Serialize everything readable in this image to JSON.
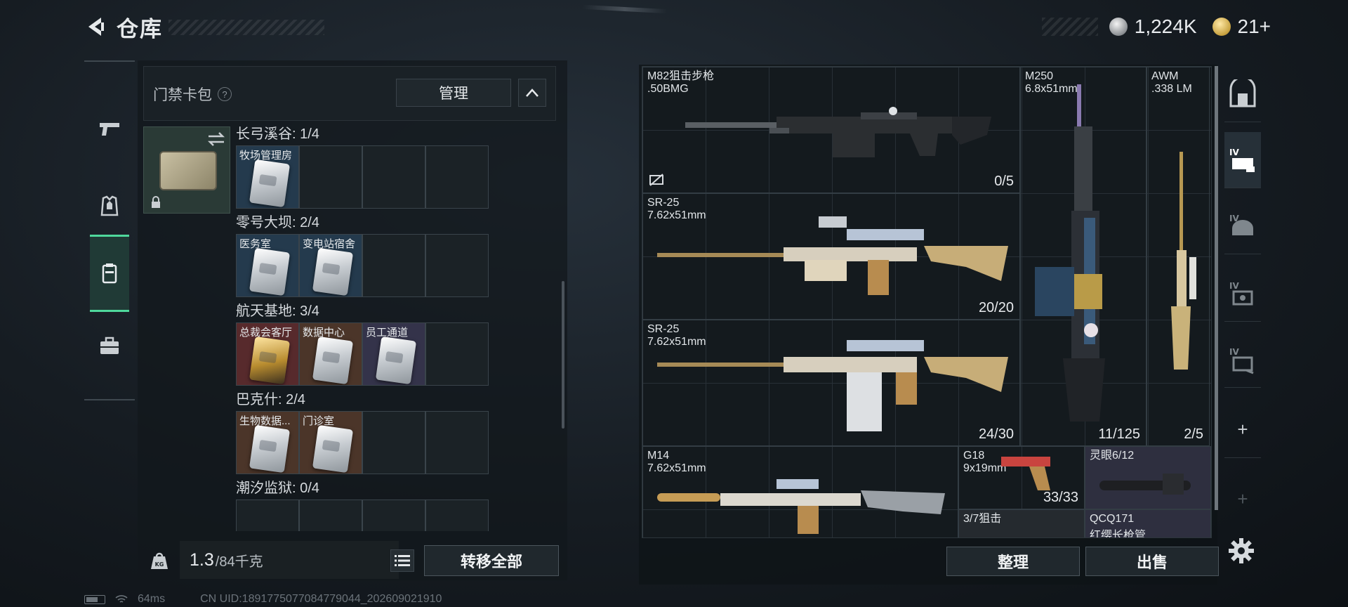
{
  "header": {
    "title": "仓库",
    "currency": [
      {
        "icon": "silver-coin-icon",
        "value": "1,224K"
      },
      {
        "icon": "gold-coin-icon",
        "value": "21+"
      }
    ]
  },
  "left_nav": [
    {
      "name": "weapons",
      "icon": "pistol-icon",
      "active": false
    },
    {
      "name": "armor",
      "icon": "armor-icon",
      "active": false
    },
    {
      "name": "keycard-pack",
      "icon": "keycard-pack-icon",
      "active": true
    },
    {
      "name": "toolbox",
      "icon": "briefcase-icon",
      "active": false
    }
  ],
  "keycard_panel": {
    "title": "门禁卡包",
    "help": "?",
    "manage_label": "管理",
    "regions": [
      {
        "label": "长弓溪谷: 1/4",
        "slots": [
          {
            "label": "牧场管理房",
            "color": "blue",
            "card": "white"
          },
          {
            "label": "",
            "color": "empty"
          },
          {
            "label": "",
            "color": "empty"
          },
          {
            "label": "",
            "color": "empty"
          }
        ]
      },
      {
        "label": "零号大坝: 2/4",
        "slots": [
          {
            "label": "医务室",
            "color": "blue",
            "card": "white"
          },
          {
            "label": "变电站宿舍",
            "color": "blue",
            "card": "white"
          },
          {
            "label": "",
            "color": "empty"
          },
          {
            "label": "",
            "color": "empty"
          }
        ]
      },
      {
        "label": "航天基地: 3/4",
        "slots": [
          {
            "label": "总裁会客厅",
            "color": "red",
            "card": "gold"
          },
          {
            "label": "数据中心",
            "color": "brown",
            "card": "white"
          },
          {
            "label": "员工通道",
            "color": "purple",
            "card": "white"
          },
          {
            "label": "",
            "color": "empty"
          }
        ]
      },
      {
        "label": "巴克什: 2/4",
        "slots": [
          {
            "label": "生物数据...",
            "color": "brown",
            "card": "white"
          },
          {
            "label": "门诊室",
            "color": "brown",
            "card": "white"
          },
          {
            "label": "",
            "color": "empty"
          },
          {
            "label": "",
            "color": "empty"
          }
        ]
      },
      {
        "label": "潮汐监狱: 0/4",
        "slots": [
          {
            "label": "",
            "color": "empty"
          },
          {
            "label": "",
            "color": "empty"
          },
          {
            "label": "",
            "color": "empty"
          },
          {
            "label": "",
            "color": "empty"
          }
        ]
      }
    ]
  },
  "weight": {
    "value": "1.3",
    "max": "/84千克",
    "icon": "kg-weight-icon"
  },
  "transfer_all_label": "转移全部",
  "status": {
    "ping": "64ms",
    "uid": "CN UID:1891775077084779044_202609021910"
  },
  "weapons": [
    {
      "name": "M82狙击步枪",
      "ammo": ".50BMG",
      "count": "0/5"
    },
    {
      "name": "M250",
      "ammo": "6.8x51mm",
      "count": "11/125"
    },
    {
      "name": "AWM",
      "ammo": ".338 LM",
      "count": "2/5"
    },
    {
      "name": "SR-25",
      "ammo": "7.62x51mm",
      "count": "20/20"
    },
    {
      "name": "SR-25",
      "ammo": "7.62x51mm",
      "count": "24/30"
    },
    {
      "name": "M14",
      "ammo": "7.62x51mm",
      "count": ""
    },
    {
      "name": "G18",
      "ammo": "9x19mm",
      "count": "33/33"
    },
    {
      "name": "灵眼6/12",
      "ammo": "",
      "count": ""
    },
    {
      "name": "3/7狙击",
      "ammo": "",
      "count": ""
    },
    {
      "name": "QCQ171",
      "ammo": "红缨长枪管",
      "count": ""
    }
  ],
  "right_nav": [
    {
      "icon": "safebox-icon"
    },
    {
      "icon": "level-iv-rig-icon"
    },
    {
      "icon": "level-iv-helmet-icon"
    },
    {
      "icon": "level-iv-vest-icon"
    },
    {
      "icon": "level-iv-backpack-icon"
    },
    {
      "icon": "add-icon",
      "label": "+"
    },
    {
      "icon": "add-icon-dim",
      "label": "+"
    }
  ],
  "actions": {
    "sort_label": "整理",
    "sell_label": "出售"
  },
  "colors": {
    "accent": "#4fd89c",
    "slot_blue": "#243a4d",
    "slot_red": "#572a2c",
    "slot_brown": "#4b3529",
    "slot_purple": "#34334a"
  }
}
